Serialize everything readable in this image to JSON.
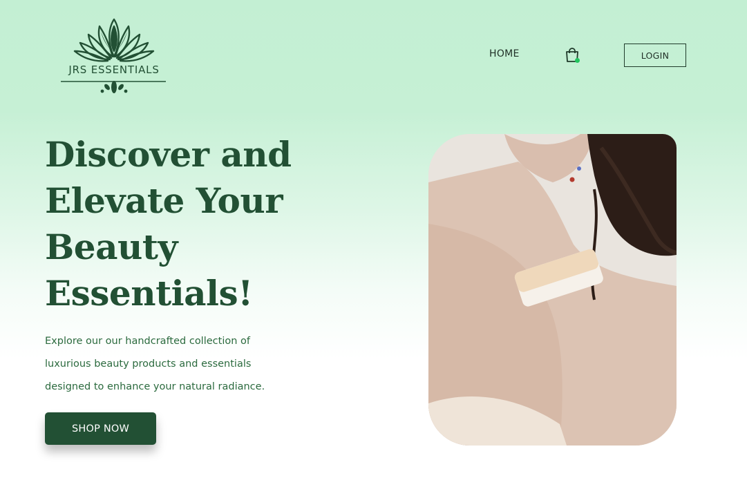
{
  "brand": {
    "name": "JRS ESSENTIALS",
    "logo_icon": "lotus-icon",
    "color": "#225034"
  },
  "nav": {
    "home_label": "HOME",
    "cart_icon": "shopping-bag-icon",
    "cart_badge_color": "#22c55e",
    "login_label": "LOGIN"
  },
  "hero": {
    "title": "Discover and Elevate Your Beauty Essentials!",
    "description": "Explore our our handcrafted collection of luxurious beauty products and essentials designed to enhance your natural radiance.",
    "cta_label": "SHOP NOW",
    "image": "woman-with-soap-bar-on-shoulder"
  },
  "colors": {
    "accent": "#225034",
    "background_top": "#c3efd3",
    "background_bottom": "#ffffff"
  }
}
